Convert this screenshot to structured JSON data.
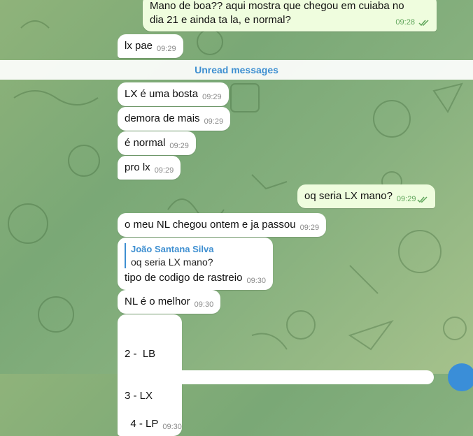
{
  "unread_label": "Unread messages",
  "messages": [
    {
      "id": "m0",
      "direction": "out",
      "lines": [
        "Mano de boa?? aqui mostra que chegou em cuiaba no",
        "dia 21 e ainda ta la, e normal?"
      ],
      "time": "09:28",
      "read": true
    },
    {
      "id": "m1",
      "direction": "in",
      "text": "lx pae",
      "time": "09:29"
    },
    {
      "id": "m2",
      "direction": "in",
      "text": "LX é uma bosta",
      "time": "09:29"
    },
    {
      "id": "m3",
      "direction": "in",
      "text": "demora de mais",
      "time": "09:29"
    },
    {
      "id": "m4",
      "direction": "in",
      "text": "é normal",
      "time": "09:29"
    },
    {
      "id": "m5",
      "direction": "in",
      "text": "pro lx",
      "time": "09:29"
    },
    {
      "id": "m6",
      "direction": "out",
      "text": "oq seria LX mano?",
      "time": "09:29",
      "read": true
    },
    {
      "id": "m7",
      "direction": "in",
      "text": "o meu NL chegou ontem e ja passou",
      "time": "09:29"
    },
    {
      "id": "m8",
      "direction": "in",
      "reply_to": {
        "name": "João Santana Silva",
        "text": "oq seria LX mano?"
      },
      "text": "tipo de codigo de rastreio",
      "time": "09:30"
    },
    {
      "id": "m9",
      "direction": "in",
      "text": "NL é o melhor",
      "time": "09:30"
    },
    {
      "id": "m10",
      "direction": "in",
      "lines": [
        "2 -  LB",
        "3 - LX",
        "4 - LP"
      ],
      "time": "09:30"
    }
  ],
  "colors": {
    "incoming_bg": "#ffffff",
    "outgoing_bg": "#effdde",
    "accent": "#3e8fd1",
    "wallpaper": "#86b07e"
  },
  "icons": {
    "read_ticks": "double-check-icon",
    "scroll_down": "scroll-down-button"
  }
}
